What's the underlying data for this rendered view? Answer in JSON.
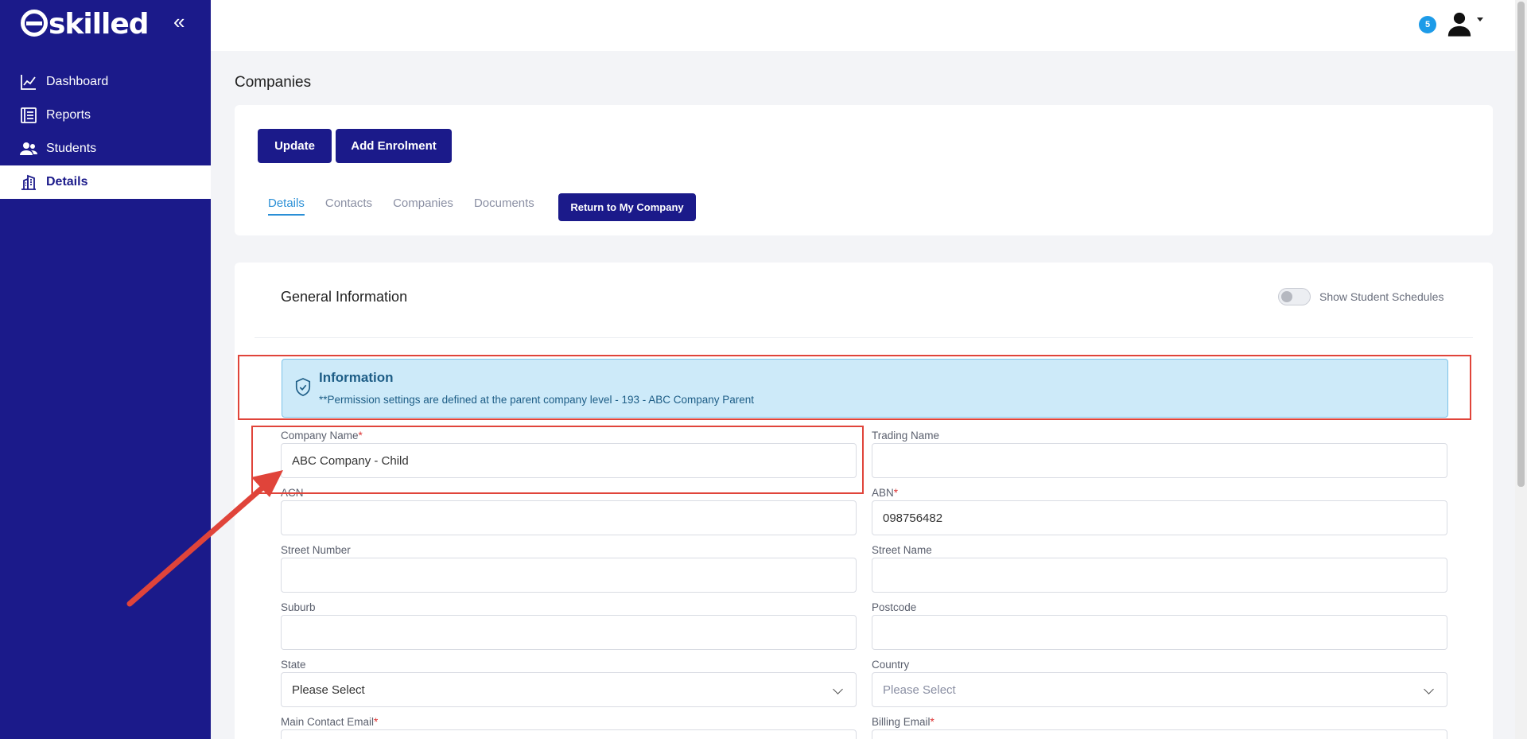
{
  "sidebar": {
    "logo": "skilled",
    "collapse_icon": "double-chevron-left-icon",
    "items": [
      {
        "label": "Dashboard",
        "icon": "chart-line-icon"
      },
      {
        "label": "Reports",
        "icon": "report-icon"
      },
      {
        "label": "Students",
        "icon": "users-icon"
      },
      {
        "label": "Details",
        "icon": "building-icon",
        "active": true
      }
    ]
  },
  "topbar": {
    "notification_count": "5",
    "avatar_icon": "user-icon"
  },
  "page": {
    "title": "Companies",
    "buttons": {
      "update": "Update",
      "add_enrolment": "Add Enrolment"
    },
    "tabs": [
      "Details",
      "Contacts",
      "Companies",
      "Documents"
    ],
    "active_tab": "Details",
    "return_button": "Return to My Company"
  },
  "section": {
    "title": "General Information",
    "toggle_label": "Show Student Schedules",
    "toggle_on": false
  },
  "alert": {
    "title": "Information",
    "text": "**Permission settings are defined at the parent company level - 193 - ABC Company Parent"
  },
  "form": {
    "company_name": {
      "label": "Company Name",
      "value": "ABC Company - Child",
      "required": true
    },
    "trading_name": {
      "label": "Trading Name",
      "value": ""
    },
    "acn": {
      "label": "ACN",
      "value": ""
    },
    "abn": {
      "label": "ABN",
      "value": "098756482",
      "required": true
    },
    "street_number": {
      "label": "Street Number",
      "value": ""
    },
    "street_name": {
      "label": "Street Name",
      "value": ""
    },
    "suburb": {
      "label": "Suburb",
      "value": ""
    },
    "postcode": {
      "label": "Postcode",
      "value": ""
    },
    "state": {
      "label": "State",
      "value": "Please Select"
    },
    "country": {
      "label": "Country",
      "value": "Please Select"
    },
    "main_contact_email": {
      "label": "Main Contact Email",
      "required": true
    },
    "billing_email": {
      "label": "Billing Email",
      "required": true
    }
  },
  "colors": {
    "sidebar": "#1b1a8a",
    "accent": "#2a8fd6",
    "alert_bg": "#cdeaf9",
    "annotation": "#e0443a"
  }
}
